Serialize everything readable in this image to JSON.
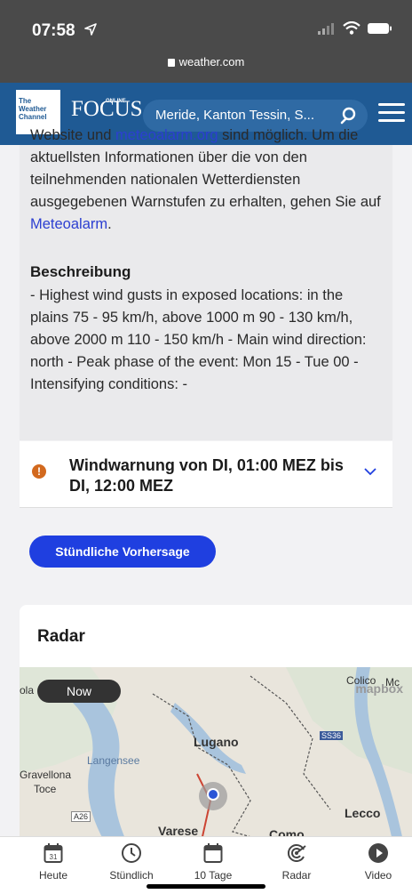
{
  "status_bar": {
    "time": "07:58",
    "url": "weather.com"
  },
  "header": {
    "twc_logo": "The Weather Channel",
    "focus_logo": "FOCUS",
    "focus_online": "ONLINE",
    "search_value": "Meride, Kanton Tessin, S..."
  },
  "alert": {
    "top_text_1": "Website und ",
    "top_link_1": "meteoalarm.org",
    "top_text_2": " sind möglich. Um die aktuellsten Informationen über die von den teilnehmenden nationalen Wetterdiensten ausgegebenen Warnstufen zu erhalten, gehen Sie auf ",
    "top_link_2": "Meteoalarm",
    "top_text_3": ".",
    "description_title": "Beschreibung",
    "description_text": "- Highest wind gusts in exposed locations: in the plains 75 - 95 km/h, above 1000 m 90 - 130 km/h, above 2000 m  110 - 150 km/h - Main wind direction: north - Peak phase of the event: Mon 15 - Tue 00 - Intensifying conditions: -"
  },
  "warning": {
    "icon": "!",
    "title": "Windwarnung von DI, 01:00 MEZ bis DI, 12:00 MEZ"
  },
  "hourly_button": "Stündliche Vorhersage",
  "radar": {
    "title": "Radar",
    "now_label": "Now",
    "mapbox_label": "mapbox",
    "labels": {
      "lugano": "Lugano",
      "langensee": "Langensee",
      "gravellona": "Gravellona",
      "toce": "Toce",
      "varese": "Varese",
      "lecco": "Lecco",
      "colico": "Colico",
      "ola": "ola",
      "como": "Como",
      "mc": "Mc",
      "a26": "A26",
      "ss36": "SS36"
    }
  },
  "bottom_nav": {
    "items": [
      {
        "label": "Heute",
        "icon": "calendar-day-icon",
        "day": "31"
      },
      {
        "label": "Stündlich",
        "icon": "clock-icon"
      },
      {
        "label": "10 Tage",
        "icon": "calendar-icon"
      },
      {
        "label": "Radar",
        "icon": "radar-icon"
      },
      {
        "label": "Video",
        "icon": "play-icon"
      }
    ]
  },
  "colors": {
    "header": "#1f5a94",
    "button": "#1f3fe0",
    "link": "#2c3fd1",
    "warning": "#d2691e"
  }
}
